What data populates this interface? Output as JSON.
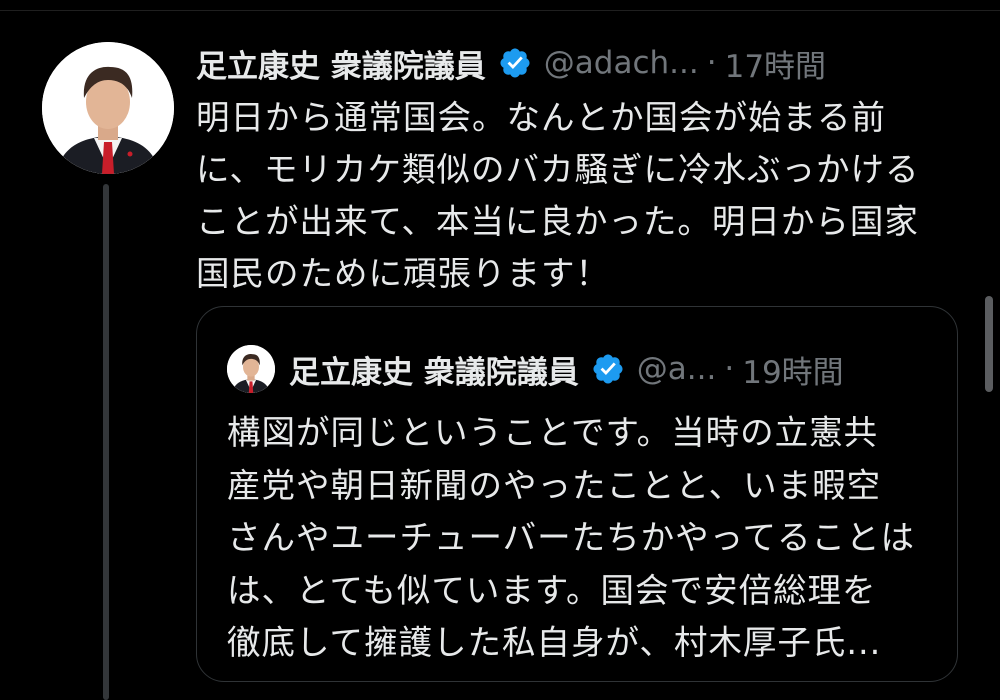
{
  "tweet": {
    "display_name": "足立康史 衆議院議員",
    "handle": "@adach...",
    "separator": "·",
    "time": "17時間",
    "text_lines": [
      "明日から通常国会。なんとか国会が始まる前",
      "に、モリカケ類似のバカ騒ぎに冷水ぶっかける",
      "ことが出来て、本当に良かった。明日から国家",
      "国民のために頑張ります！"
    ]
  },
  "quoted_tweet": {
    "display_name": "足立康史 衆議院議員",
    "handle": "@a...",
    "separator": "·",
    "time": "19時間",
    "text_lines": [
      "構図が同じということです。当時の立憲共",
      "産党や朝日新聞のやったことと、いま暇空",
      "さんやユーチューバーたちかやってることは",
      "は、とても似ています。国会で安倍総理を",
      "徹底して擁護した私自身が、村木厚子氏..."
    ]
  },
  "icons": {
    "verified": "verified-badge-icon",
    "avatar": "profile-photo"
  },
  "colors": {
    "background": "#000000",
    "text": "#e7e9ea",
    "muted": "#71767b",
    "verified": "#1d9bf0",
    "border": "#2f3336"
  }
}
